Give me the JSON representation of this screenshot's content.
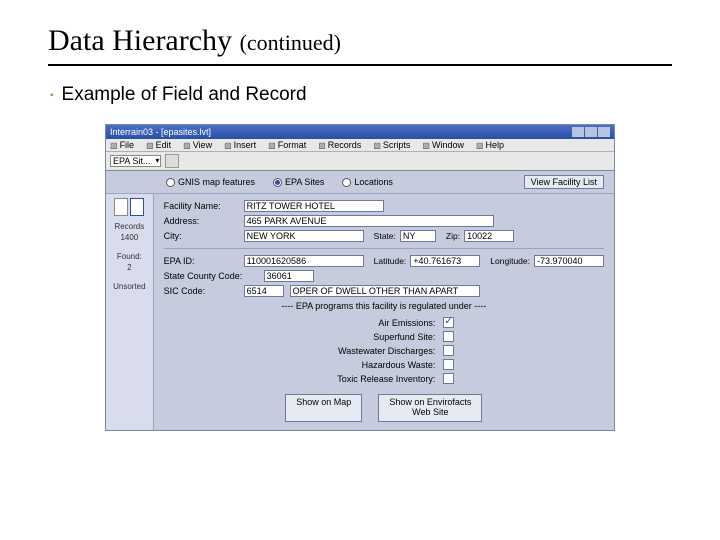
{
  "slide": {
    "title_main": "Data Hierarchy",
    "title_cont": "(continued)",
    "subtitle": "Example of Field and Record"
  },
  "window": {
    "title": "Interrain03 - [epasites.lvt]",
    "menus": [
      "File",
      "Edit",
      "View",
      "Insert",
      "Format",
      "Records",
      "Scripts",
      "Window",
      "Help"
    ],
    "layer_select": "EPA Sit..."
  },
  "radios": {
    "gnis": "GNIS map features",
    "epa": "EPA Sites",
    "loc": "Locations",
    "viewbtn": "View Facility List"
  },
  "sidebar": {
    "records_lbl": "Records",
    "records": "1400",
    "found_lbl": "Found:",
    "found": "2",
    "unsorted": "Unsorted"
  },
  "form": {
    "facility_name_lbl": "Facility Name:",
    "facility_name": "RITZ TOWER HOTEL",
    "address_lbl": "Address:",
    "address": "465 PARK AVENUE",
    "city_lbl": "City:",
    "city": "NEW YORK",
    "state_lbl": "State:",
    "state": "NY",
    "zip_lbl": "Zip:",
    "zip": "10022",
    "epaid_lbl": "EPA ID:",
    "epaid": "110001620586",
    "lat_lbl": "Latitude:",
    "lat": "+40.761673",
    "lon_lbl": "Longitude:",
    "lon": "-73.970040",
    "county_lbl": "State County Code:",
    "county": "36061",
    "sic_lbl": "SIC Code:",
    "sic": "6514",
    "sic_desc": "OPER OF DWELL OTHER THAN APART",
    "programs_header": "---- EPA programs this facility is regulated under ----",
    "air": "Air Emissions:",
    "superfund": "Superfund Site:",
    "wastewater": "Wastewater Discharges:",
    "hazwaste": "Hazardous Waste:",
    "tri": "Toxic Release Inventory:",
    "showmap": "Show on Map",
    "showweb1": "Show on Envirofacts",
    "showweb2": "Web Site"
  }
}
